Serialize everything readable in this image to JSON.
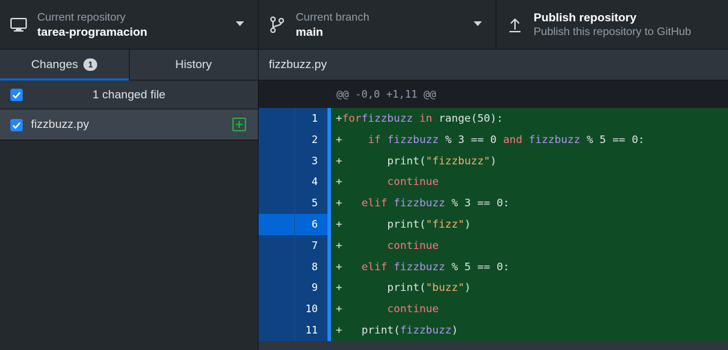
{
  "toolbar": {
    "repo": {
      "label": "Current repository",
      "value": "tarea-programacion"
    },
    "branch": {
      "label": "Current branch",
      "value": "main"
    },
    "publish": {
      "title": "Publish repository",
      "subtitle": "Publish this repository to GitHub"
    }
  },
  "sidebar": {
    "tabs": [
      {
        "label": "Changes",
        "count": "1",
        "active": true
      },
      {
        "label": "History",
        "active": false
      }
    ],
    "changed_count_text": "1 changed file",
    "files": [
      {
        "name": "fizzbuzz.py",
        "status": "added"
      }
    ]
  },
  "diff": {
    "filename": "fizzbuzz.py",
    "hunk_header": "@@ -0,0 +1,11 @@",
    "selected_line": 6,
    "lines": [
      {
        "num": "1",
        "prefix": "+",
        "tokens": [
          [
            "kw",
            "for"
          ],
          [
            "",
            ""
          ],
          [
            " ",
            ""
          ],
          [
            "nm",
            "fizzbuzz"
          ],
          [
            "",
            " "
          ],
          [
            "kw",
            "in"
          ],
          [
            "",
            " range(50):"
          ]
        ]
      },
      {
        "num": "2",
        "prefix": "+",
        "tokens": [
          [
            "",
            " "
          ],
          [
            "",
            "   "
          ],
          [
            "kw",
            "if"
          ],
          [
            "",
            " "
          ],
          [
            "nm",
            "fizzbuzz"
          ],
          [
            "",
            " % 3 == 0 "
          ],
          [
            "kw",
            "and"
          ],
          [
            "",
            " "
          ],
          [
            "nm",
            "fizzbuzz"
          ],
          [
            "",
            " % 5 == 0:"
          ]
        ]
      },
      {
        "num": "3",
        "prefix": "+",
        "tokens": [
          [
            "",
            "       print("
          ],
          [
            "st",
            "\"fizzbuzz\""
          ],
          [
            "",
            ")"
          ]
        ]
      },
      {
        "num": "4",
        "prefix": "+",
        "tokens": [
          [
            "",
            "       "
          ],
          [
            "kw",
            "continue"
          ]
        ]
      },
      {
        "num": "5",
        "prefix": "+",
        "tokens": [
          [
            "",
            "   "
          ],
          [
            "kw",
            "elif"
          ],
          [
            "",
            " "
          ],
          [
            "nm",
            "fizzbuzz"
          ],
          [
            "",
            " % 3 == 0:"
          ]
        ]
      },
      {
        "num": "6",
        "prefix": "+",
        "tokens": [
          [
            "",
            "       print("
          ],
          [
            "st",
            "\"fizz\""
          ],
          [
            "",
            ")"
          ]
        ]
      },
      {
        "num": "7",
        "prefix": "+",
        "tokens": [
          [
            "",
            "       "
          ],
          [
            "kw",
            "continue"
          ]
        ]
      },
      {
        "num": "8",
        "prefix": "+",
        "tokens": [
          [
            "",
            "   "
          ],
          [
            "kw",
            "elif"
          ],
          [
            "",
            " "
          ],
          [
            "nm",
            "fizzbuzz"
          ],
          [
            "",
            " % 5 == 0:"
          ]
        ]
      },
      {
        "num": "9",
        "prefix": "+",
        "tokens": [
          [
            "",
            "       print("
          ],
          [
            "st",
            "\"buzz\""
          ],
          [
            "",
            ")"
          ]
        ]
      },
      {
        "num": "10",
        "prefix": "+",
        "tokens": [
          [
            "",
            "       "
          ],
          [
            "kw",
            "continue"
          ]
        ]
      },
      {
        "num": "11",
        "prefix": "+",
        "tokens": [
          [
            "",
            "   print("
          ],
          [
            "nm",
            "fizzbuzz"
          ],
          [
            "",
            ")"
          ]
        ]
      }
    ]
  },
  "colors": {
    "accent": "#2188ff",
    "added_bg": "#0f4c25",
    "gutter_bg": "#0e4283",
    "selected_gutter": "#0366d6",
    "keyword": "#f97583",
    "name": "#b392f0",
    "string": "#ffab70"
  }
}
